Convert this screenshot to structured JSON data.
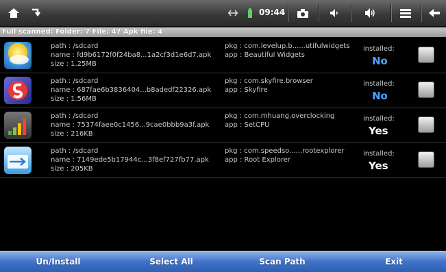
{
  "statusbar": {
    "icons": [
      "home-icon",
      "back-swap-icon",
      "usb-icon",
      "battery-icon",
      "camera-icon",
      "volume-down-icon",
      "volume-up-icon",
      "menu-icon",
      "back-arrow-icon"
    ],
    "clock": "09:44"
  },
  "summary": "Full scanned: Folder: 7 File: 47 Apk file: 4",
  "apps": [
    {
      "path": "path : /sdcard",
      "name": "name : fd9b6172f0f24ba8...1a2cf3d1e6d7.apk",
      "size": "size : 1.25MB",
      "pkg": "pkg : com.levelup.b......utifulwidgets",
      "app": "app : Beautiful Widgets",
      "installed_label": "installed:",
      "installed": "No"
    },
    {
      "path": "path : /sdcard",
      "name": "name : 687fae6b3836404...b8adedf22326.apk",
      "size": "size : 1.56MB",
      "pkg": "pkg : com.skyfire.browser",
      "app": "app : Skyfire",
      "installed_label": "installed:",
      "installed": "No"
    },
    {
      "path": "path : /sdcard",
      "name": "name : 75374faee0c1456...9cae0bbb9a3f.apk",
      "size": "size : 216KB",
      "pkg": "pkg : com.mhuang.overclocking",
      "app": "app : SetCPU",
      "installed_label": "installed:",
      "installed": "Yes"
    },
    {
      "path": "path : /sdcard",
      "name": "name : 7149ede5b17944c...3f8ef727fb77.apk",
      "size": "size : 205KB",
      "pkg": "pkg : com.speedso......rootexplorer",
      "app": "app : Root Explorer",
      "installed_label": "installed:",
      "installed": "Yes"
    }
  ],
  "colors": {
    "no": "#4aa0ff",
    "yes": "#ffffff",
    "bottom_bar": "#3f73c9"
  },
  "buttons": {
    "uninstall": "Un/Install",
    "select_all": "Select All",
    "scan_path": "Scan Path",
    "exit": "Exit"
  }
}
